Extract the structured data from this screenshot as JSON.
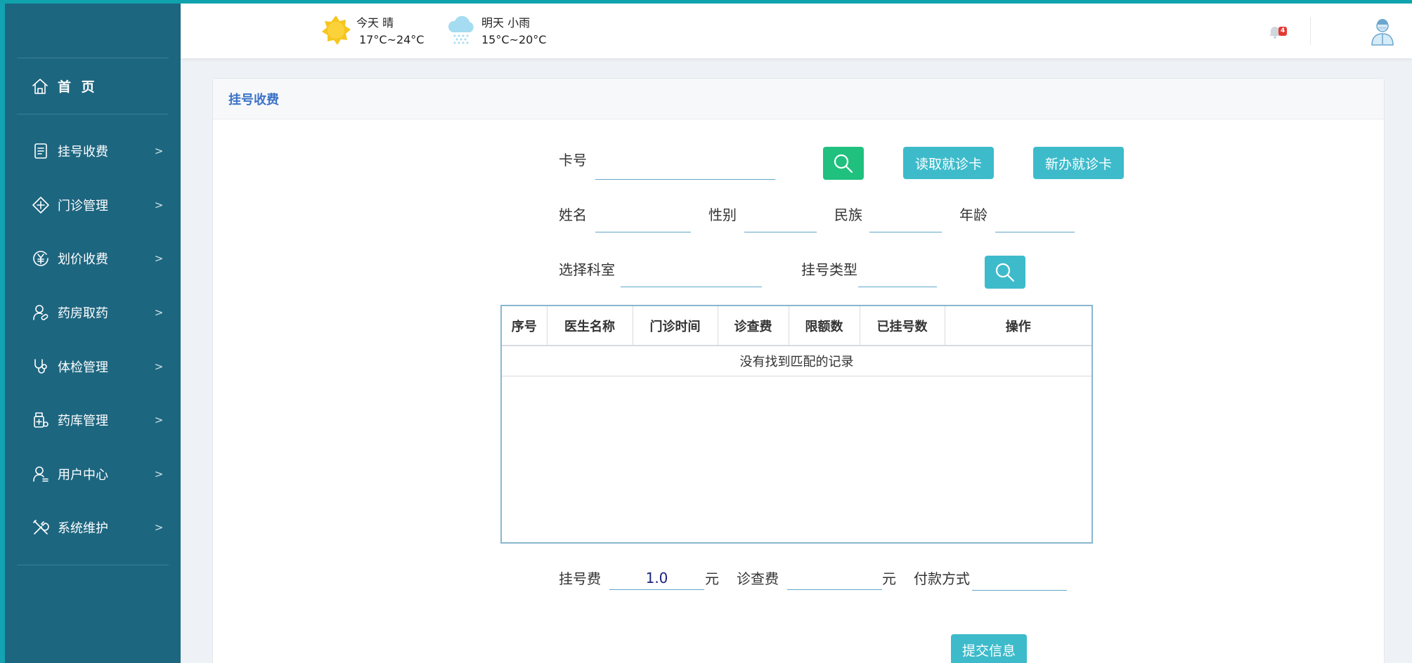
{
  "sidebar": {
    "home": "首 页",
    "items": [
      {
        "label": "挂号收费",
        "icon": "register-icon"
      },
      {
        "label": "门诊管理",
        "icon": "clinic-icon"
      },
      {
        "label": "划价收费",
        "icon": "yen-icon"
      },
      {
        "label": "药房取药",
        "icon": "pharmacy-user-icon"
      },
      {
        "label": "体检管理",
        "icon": "stethoscope-icon"
      },
      {
        "label": "药库管理",
        "icon": "medicine-bottle-icon"
      },
      {
        "label": "用户中心",
        "icon": "user-icon"
      },
      {
        "label": "系统维护",
        "icon": "tools-icon"
      }
    ]
  },
  "header": {
    "weather_today": {
      "day": "今天 晴",
      "temp": "17°C~24°C",
      "icon": "sun-icon"
    },
    "weather_tomorrow": {
      "day": "明天 小雨",
      "temp": "15°C~20°C",
      "icon": "rain-cloud-icon"
    },
    "notification_count": "4"
  },
  "panel": {
    "title": "挂号收费",
    "card_label": "卡号",
    "card_value": "",
    "read_card_button": "读取就诊卡",
    "new_card_button": "新办就诊卡",
    "name_label": "姓名",
    "gender_label": "性别",
    "ethnicity_label": "民族",
    "age_label": "年龄",
    "department_label": "选择科室",
    "reg_type_label": "挂号类型",
    "table": {
      "columns": [
        "序号",
        "医生名称",
        "门诊时间",
        "诊查费",
        "限额数",
        "已挂号数",
        "操作"
      ],
      "empty_message": "没有找到匹配的记录"
    },
    "reg_fee_label": "挂号费",
    "reg_fee_value": "1.0",
    "yuan_label": "元",
    "exam_fee_label": "诊查费",
    "exam_fee_value": "",
    "payment_label": "付款方式",
    "payment_value": "",
    "submit_button": "提交信息"
  },
  "colors": {
    "sidebar_bg": "#1d6680",
    "accent": "#3dbbcb",
    "search_green": "#20c07f",
    "panel_title": "#3c73c7"
  }
}
